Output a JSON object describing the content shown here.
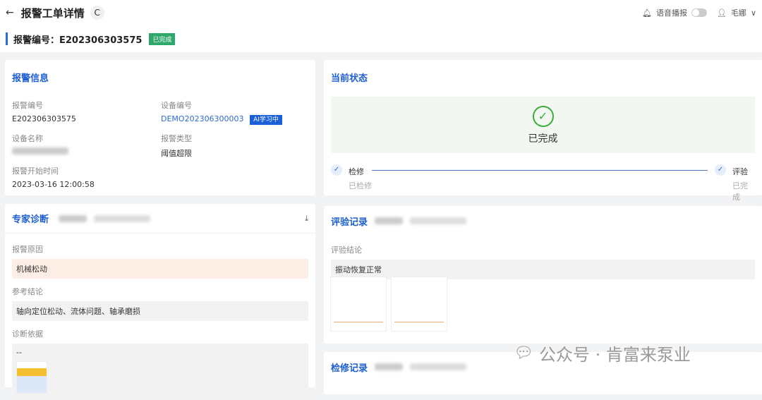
{
  "header": {
    "title": "报警工单详情",
    "voice_label": "语音播报",
    "user": "毛娜"
  },
  "subheader": {
    "label": "报警编号：E202306303575",
    "status": "已完成"
  },
  "alarm_info": {
    "title": "报警信息",
    "fields": [
      {
        "label": "报警编号",
        "value": "E202306303575"
      },
      {
        "label": "设备编号",
        "value": "DEMO202306300003",
        "tag": "AI学习中"
      },
      {
        "label": "设备名称",
        "value": ""
      },
      {
        "label": "报警类型",
        "value": "阈值超限"
      },
      {
        "label": "报警开始时间",
        "value": "2023-03-16 12:00:58"
      }
    ]
  },
  "status": {
    "title": "当前状态",
    "current": "已完成",
    "steps": [
      {
        "name": "检修",
        "sub": "已检修"
      },
      {
        "name": "评验",
        "sub": "已完成"
      }
    ]
  },
  "expert": {
    "title": "专家诊断",
    "cause_label": "报警原因",
    "cause": "机械松动",
    "conclusion_label": "参考结论",
    "conclusion": "轴向定位松动、流体问题、轴承磨损",
    "basis_label": "诊断依据",
    "basis": "--"
  },
  "review": {
    "title": "评验记录",
    "conclusion_label": "评验结论",
    "conclusion": "振动恢复正常"
  },
  "repair": {
    "title": "检修记录"
  },
  "watermark": "公众号 · 肯富来泵业",
  "colors": {
    "accent": "#1d5fd1",
    "success": "#2ea86b",
    "cause_bg": "#fdefe6"
  }
}
